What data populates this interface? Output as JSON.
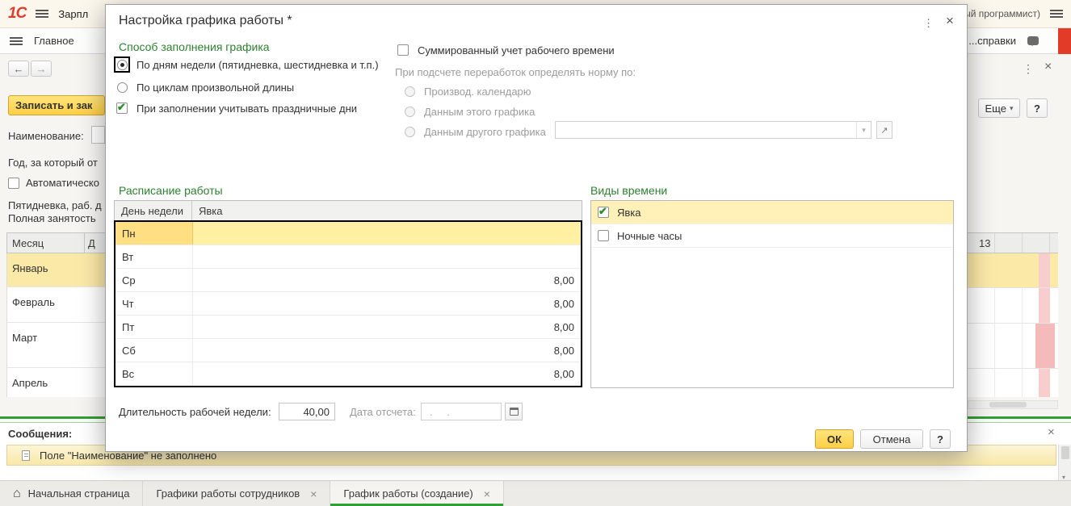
{
  "colors": {
    "accent_green": "#2e8031",
    "brand_red": "#e23c29",
    "button_yellow": "#fecf45",
    "selection_yellow": "#fbe9a8",
    "weekend_pink": "#f7cdcd",
    "tab_green": "#2fa033"
  },
  "icons": {
    "back": "←",
    "forward": "→",
    "kebab": "⋮",
    "close": "×",
    "dropdown": "▾",
    "home": "⌂",
    "open": "↗",
    "scroll_down": "▾"
  },
  "app": {
    "brand": "1С",
    "title": "Зарпл",
    "user_suffix": "...ный программист)",
    "menu_main": "Главное",
    "menu_right": "...справки"
  },
  "toolbar": {
    "save": "Записать и зак",
    "more": "Еще",
    "help": "?"
  },
  "form": {
    "name_label": "Наименование:",
    "year_label": "Год, за который от",
    "auto_label": "Автоматическо",
    "five_day_label": "Пятидневка, раб. д",
    "full_time_label": "Полная занятость",
    "month_col": "Месяц",
    "day_col": "Д",
    "day13": "13",
    "months": [
      "Январь",
      "Февраль",
      "Март",
      "Апрель"
    ]
  },
  "messages": {
    "header": "Сообщения:",
    "items": [
      {
        "text": "Поле \"Наименование\" не заполнено"
      }
    ]
  },
  "tabs": [
    {
      "label": "Начальная страница"
    },
    {
      "label": "Графики работы сотрудников"
    },
    {
      "label": "График работы (создание)"
    }
  ],
  "dialog": {
    "title": "Настройка графика работы *",
    "fill": {
      "heading": "Способ заполнения графика",
      "radio_week": "По дням недели (пятидневка, шестидневка и т.п.)",
      "radio_cycle": "По циклам произвольной длины",
      "holidays": "При заполнении учитывать праздничные дни"
    },
    "summary": {
      "checkbox": "Суммированный учет рабочего времени",
      "norm_label": "При подсчете переработок определять норму по:",
      "r1": "Производ. календарю",
      "r2": "Данным этого графика",
      "r3": "Данным другого графика",
      "combo_value": ""
    },
    "schedule": {
      "heading": "Расписание работы",
      "col_day": "День недели",
      "col_att": "Явка",
      "rows": [
        {
          "day": "Пн",
          "value": ""
        },
        {
          "day": "Вт",
          "value": ""
        },
        {
          "day": "Ср",
          "value": "8,00"
        },
        {
          "day": "Чт",
          "value": "8,00"
        },
        {
          "day": "Пт",
          "value": "8,00"
        },
        {
          "day": "Сб",
          "value": "8,00"
        },
        {
          "day": "Вс",
          "value": "8,00"
        }
      ]
    },
    "types": {
      "heading": "Виды времени",
      "items": [
        {
          "label": "Явка",
          "checked": true
        },
        {
          "label": "Ночные часы",
          "checked": false
        }
      ]
    },
    "footer": {
      "week_label": "Длительность рабочей недели:",
      "week_value": "40,00",
      "date_label": "Дата отсчета:",
      "date_value": ". .",
      "ok": "ОК",
      "cancel": "Отмена",
      "help": "?"
    }
  }
}
